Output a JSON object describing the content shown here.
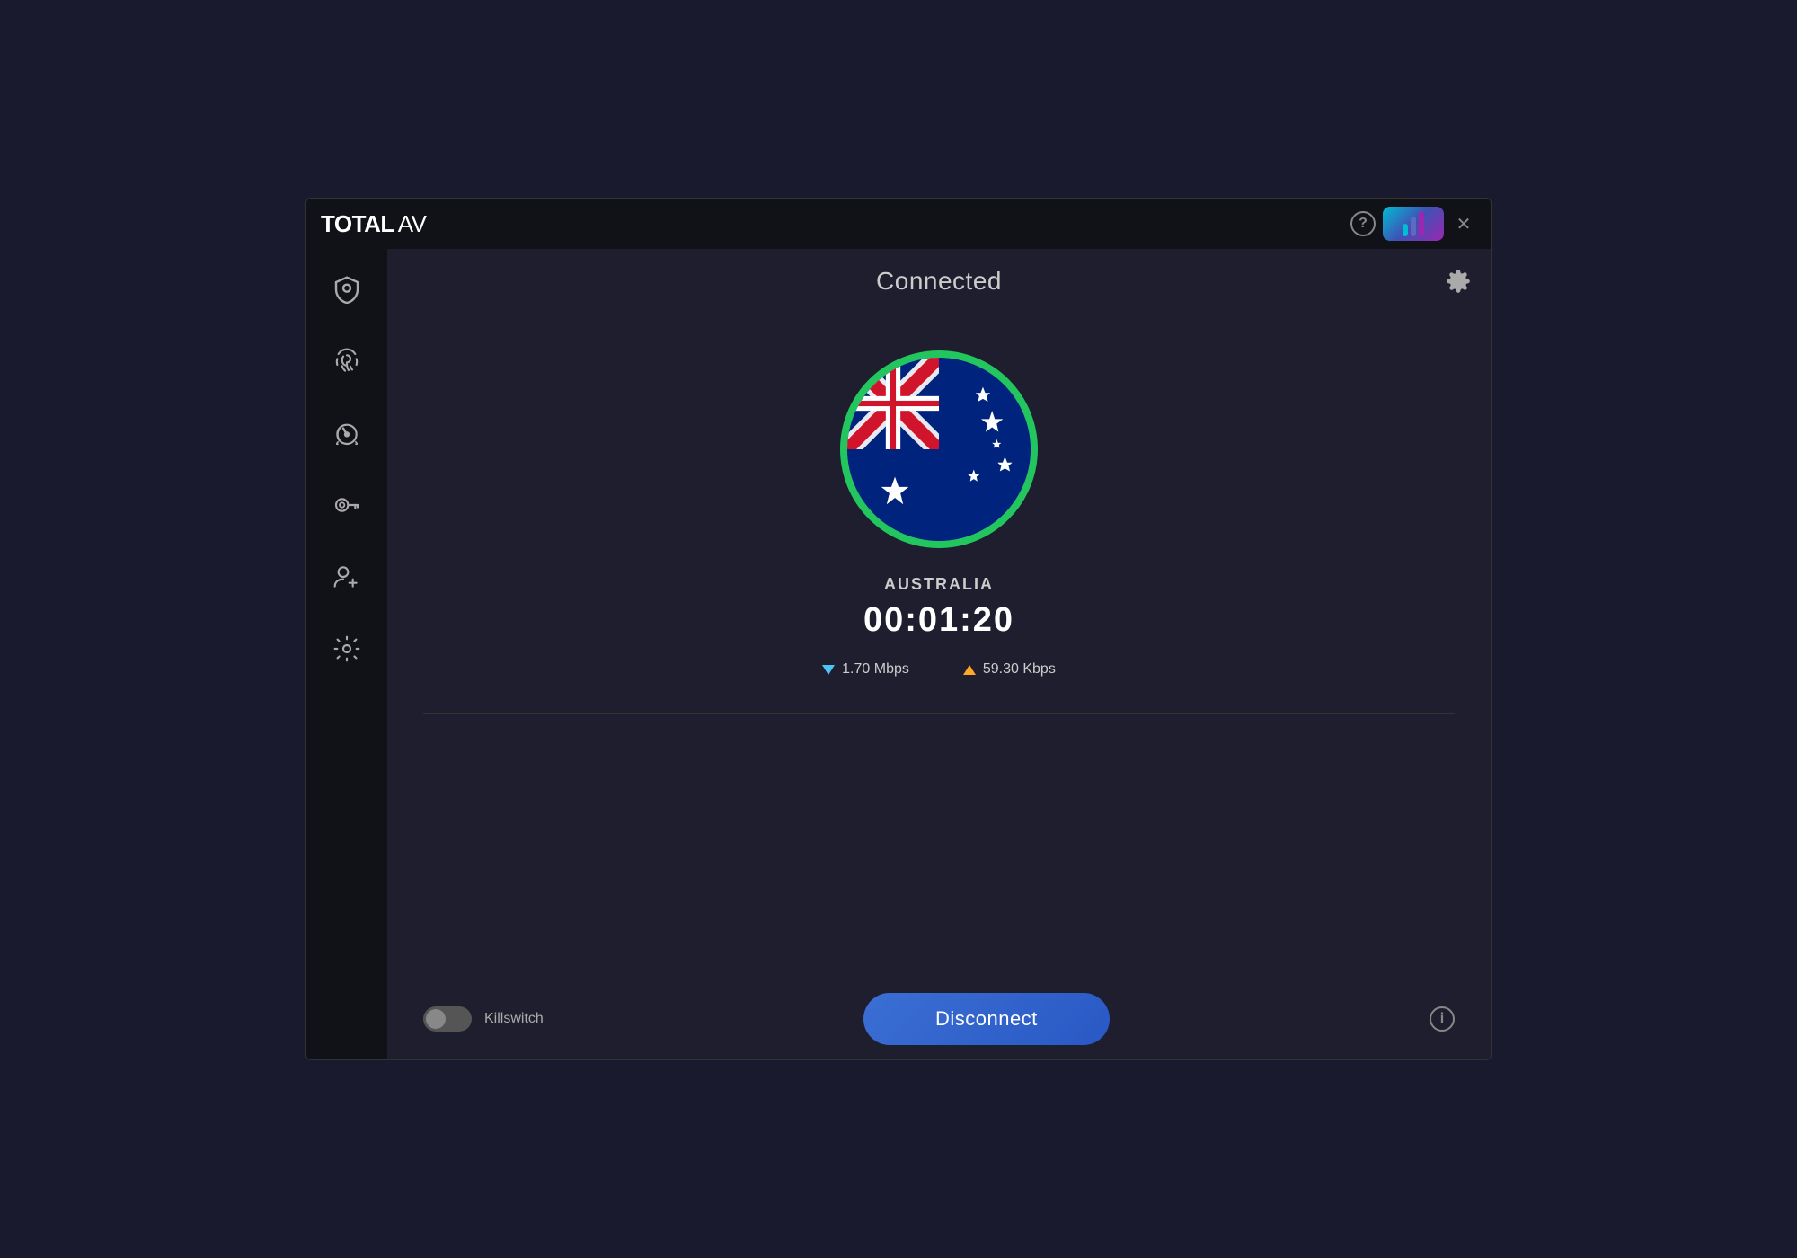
{
  "app": {
    "title_total": "TOTAL",
    "title_av": "AV",
    "help_label": "?",
    "close_label": "✕"
  },
  "header": {
    "connected_status": "Connected",
    "settings_aria": "Settings"
  },
  "vpn": {
    "country": "AUSTRALIA",
    "timer": "00:01:20",
    "download_speed": "1.70 Mbps",
    "upload_speed": "59.30 Kbps",
    "flag_alt": "Australia Flag"
  },
  "bottom": {
    "killswitch_label": "Killswitch",
    "disconnect_label": "Disconnect",
    "info_label": "i"
  },
  "sidebar": {
    "shield_aria": "Shield / Protection",
    "fingerprint_aria": "Safe Browsing",
    "speedometer_aria": "System Tune-up",
    "key_aria": "Password Vault",
    "add_user_aria": "Refer a Friend",
    "settings_aria": "Settings"
  }
}
